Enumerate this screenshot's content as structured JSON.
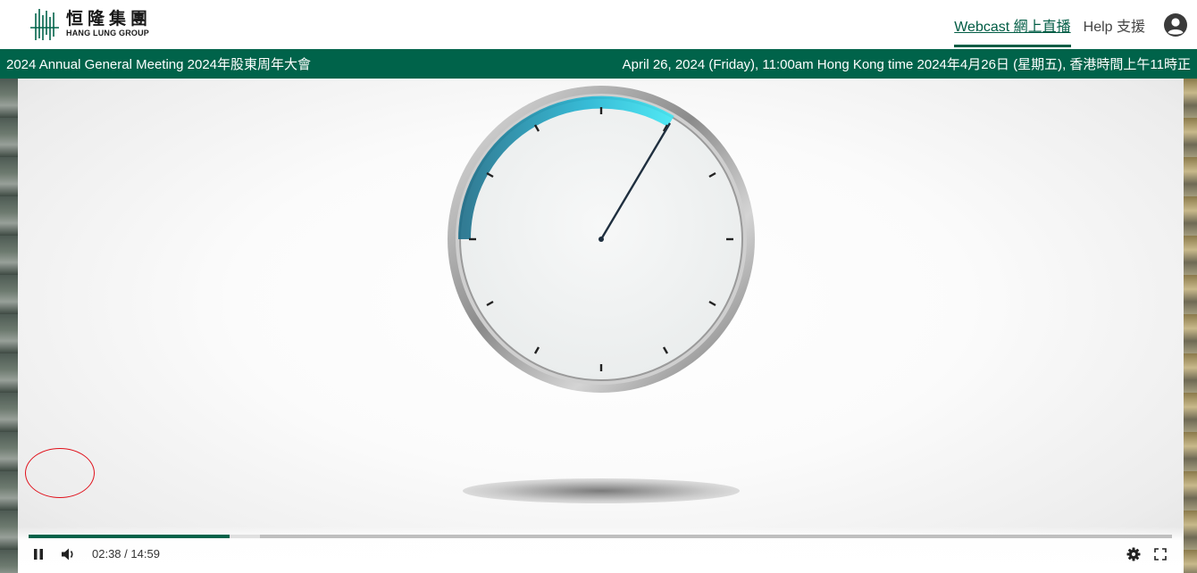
{
  "header": {
    "logo": {
      "cn": "恒隆集團",
      "en": "HANG LUNG GROUP",
      "brand_color": "#00634a"
    },
    "nav": [
      {
        "label": "Webcast 網上直播",
        "active": true
      },
      {
        "label": "Help 支援",
        "active": false
      }
    ],
    "account_icon": "user-circle-icon"
  },
  "titlebar": {
    "event": "2024 Annual General Meeting 2024年股東周年大會",
    "datetime": "April 26, 2024 (Friday), 11:00am Hong Kong time 2024年4月26日 (星期五), 香港時間上午11時正"
  },
  "player": {
    "state": "playing",
    "current_time": "02:38",
    "separator": "/",
    "duration": "14:59",
    "played_fraction": 0.176,
    "buffered_fraction": 0.202,
    "icons": {
      "pause": "pause-icon",
      "volume": "volume-icon",
      "settings": "gear-icon",
      "fullscreen": "fullscreen-icon"
    }
  }
}
